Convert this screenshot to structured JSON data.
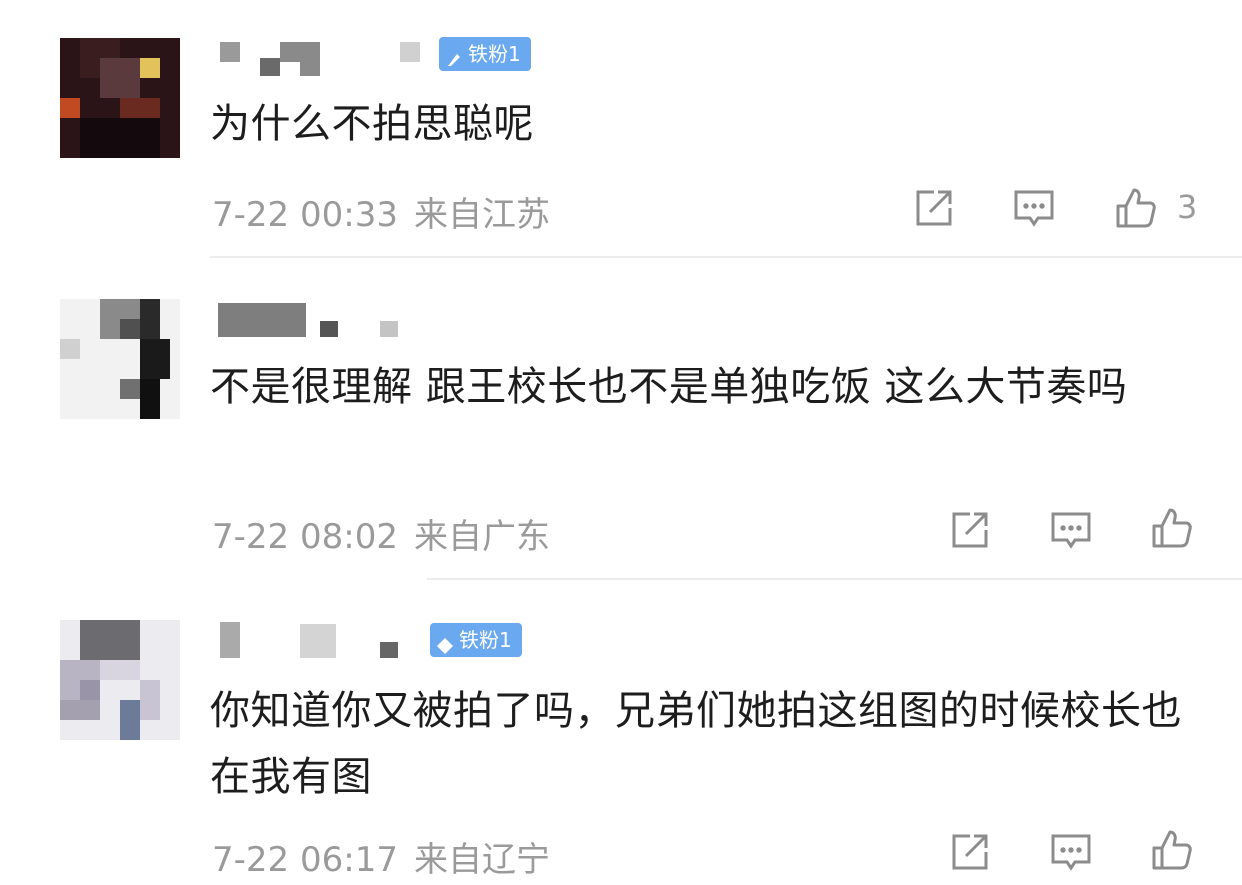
{
  "comments": [
    {
      "badge": "铁粉1",
      "text": "为什么不拍思聪呢",
      "date": "7-22 00:33",
      "location": "来自江苏",
      "likes": "3",
      "icons": [
        "share-icon",
        "comment-icon",
        "like-icon"
      ]
    },
    {
      "badge": "",
      "text": "不是很理解 跟王校长也不是单独吃饭 这么大节奏吗",
      "date": "7-22 08:02",
      "location": "来自广东",
      "likes": "",
      "icons": [
        "share-icon",
        "comment-icon",
        "like-icon"
      ]
    },
    {
      "badge": "铁粉1",
      "text": "你知道你又被拍了吗，兄弟们她拍这组图的时候校长也在我有图",
      "date": "7-22 06:17",
      "location": "来自辽宁",
      "likes": "",
      "icons": [
        "share-icon",
        "comment-icon",
        "like-icon"
      ]
    }
  ],
  "colors": {
    "badge": "#6aa8f0",
    "meta": "#9a9a9a",
    "text": "#1d1d1d",
    "divider": "#ededed"
  }
}
